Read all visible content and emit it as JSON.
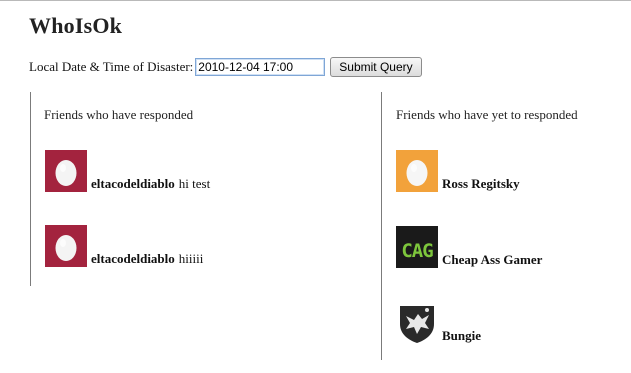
{
  "app": {
    "title": "WhoIsOk"
  },
  "query": {
    "label": "Local Date & Time of Disaster:",
    "datetime_value": "2010-12-04 17:00",
    "submit_label": "Submit Query"
  },
  "responded": {
    "heading": "Friends who have responded",
    "friends": [
      {
        "name": "eltacodeldiablo",
        "message": "hi test",
        "avatar_icon": "default-egg-avatar-icon",
        "avatar_color": "#a3233e"
      },
      {
        "name": "eltacodeldiablo",
        "message": "hiiiii",
        "avatar_icon": "default-egg-avatar-icon",
        "avatar_color": "#a3233e"
      }
    ]
  },
  "pending": {
    "heading": "Friends who have yet to responded",
    "friends": [
      {
        "name": "Ross Regitsky",
        "avatar_icon": "default-egg-avatar-icon",
        "avatar_color": "#f2a23b"
      },
      {
        "name": "Cheap Ass Gamer",
        "avatar_icon": "cag-logo-avatar-icon",
        "avatar_color": "#1a1a1a",
        "avatar_text": "CAG"
      },
      {
        "name": "Bungie",
        "avatar_icon": "bungie-logo-avatar-icon",
        "avatar_color": "#2a2a2a"
      }
    ]
  }
}
